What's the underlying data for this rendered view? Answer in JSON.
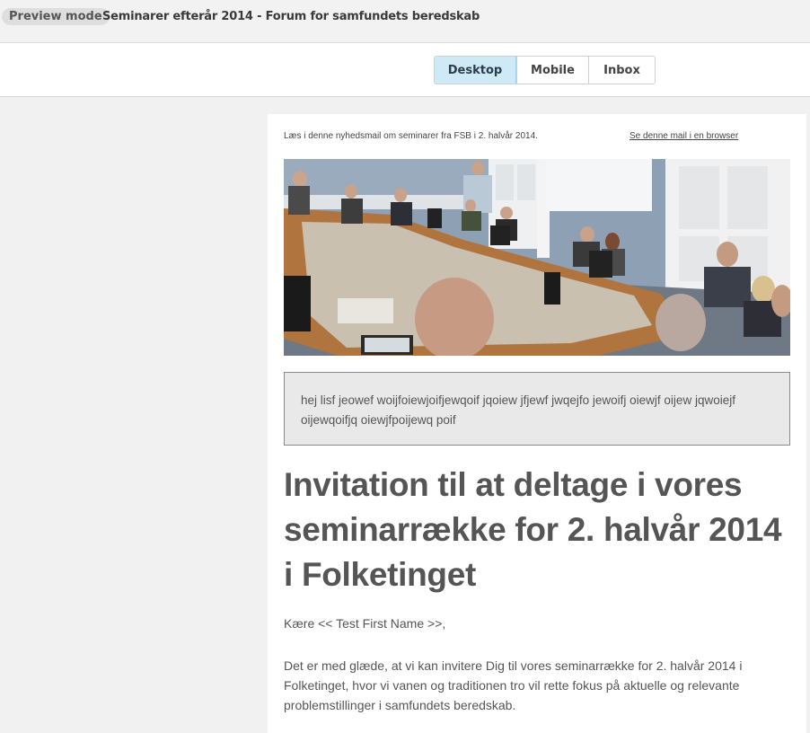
{
  "topbar": {
    "mode_label": "Preview mode",
    "title": "Seminarer efterår 2014 - Forum for samfundets beredskab"
  },
  "device_switch": {
    "desktop": "Desktop",
    "mobile": "Mobile",
    "inbox": "Inbox",
    "active": "Desktop",
    "active_color": "#cdeaf6"
  },
  "email": {
    "preheader": "Læs i denne nyhedsmail om seminarer fra FSB i 2. halvår 2014.",
    "browser_link": "Se denne mail i en browser",
    "intro_box": "hej lisf jeowef woijfoiewjoifjewqoif jqoiew jfjewf jwqejfo jewoifj oiewjf oijew jqwoiejf oijewqoifjq oiewjfpoijewq poif",
    "headline": "Invitation til at deltage i vores seminarrække for 2. halvår 2014 i Folketinget",
    "greeting": "Kære << Test First Name >>,",
    "body": "Det er med glæde, at vi kan invitere Dig til vores seminarrække for 2. halvår 2014 i Folketinget, hvor vi vanen og traditionen tro vil rette fokus på aktuelle og relevante problemstillinger i samfundets beredskab."
  }
}
